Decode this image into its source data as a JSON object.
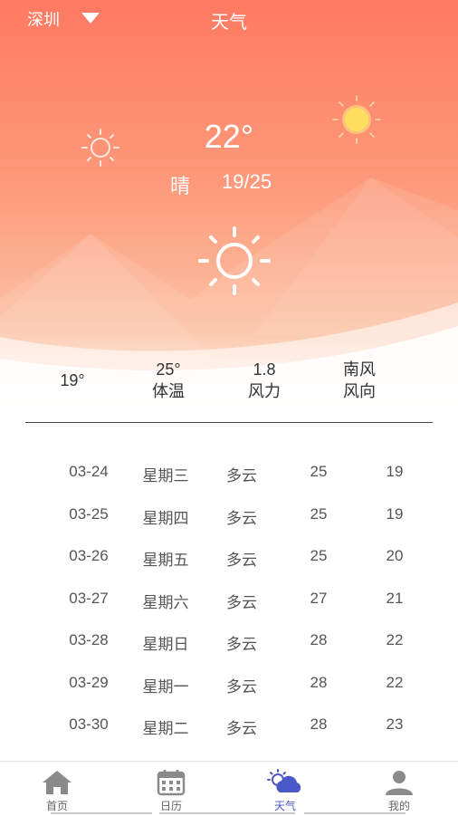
{
  "header": {
    "city": "深圳",
    "title": "天气"
  },
  "current": {
    "temperature": "22°",
    "condition": "晴",
    "range": "19/25"
  },
  "stats": [
    {
      "value": "19°",
      "label": ""
    },
    {
      "value": "25°",
      "label": "体温"
    },
    {
      "value": "1.8",
      "label": "风力"
    },
    {
      "value": "南风",
      "label": "风向"
    }
  ],
  "forecast": [
    {
      "date": "03-24",
      "weekday": "星期三",
      "condition": "多云",
      "high": "25",
      "low": "19"
    },
    {
      "date": "03-25",
      "weekday": "星期四",
      "condition": "多云",
      "high": "25",
      "low": "19"
    },
    {
      "date": "03-26",
      "weekday": "星期五",
      "condition": "多云",
      "high": "25",
      "low": "20"
    },
    {
      "date": "03-27",
      "weekday": "星期六",
      "condition": "多云",
      "high": "27",
      "low": "21"
    },
    {
      "date": "03-28",
      "weekday": "星期日",
      "condition": "多云",
      "high": "28",
      "low": "22"
    },
    {
      "date": "03-29",
      "weekday": "星期一",
      "condition": "多云",
      "high": "28",
      "low": "22"
    },
    {
      "date": "03-30",
      "weekday": "星期二",
      "condition": "多云",
      "high": "28",
      "low": "23"
    }
  ],
  "tabs": [
    {
      "label": "首页",
      "icon": "home-icon",
      "active": false
    },
    {
      "label": "日历",
      "icon": "calendar-icon",
      "active": false
    },
    {
      "label": "天气",
      "icon": "weather-icon",
      "active": true
    },
    {
      "label": "我的",
      "icon": "user-icon",
      "active": false
    }
  ],
  "colors": {
    "accent": "#4a58c8",
    "hero_top": "#ff7a62",
    "hero_bottom": "#fcc3a5"
  }
}
